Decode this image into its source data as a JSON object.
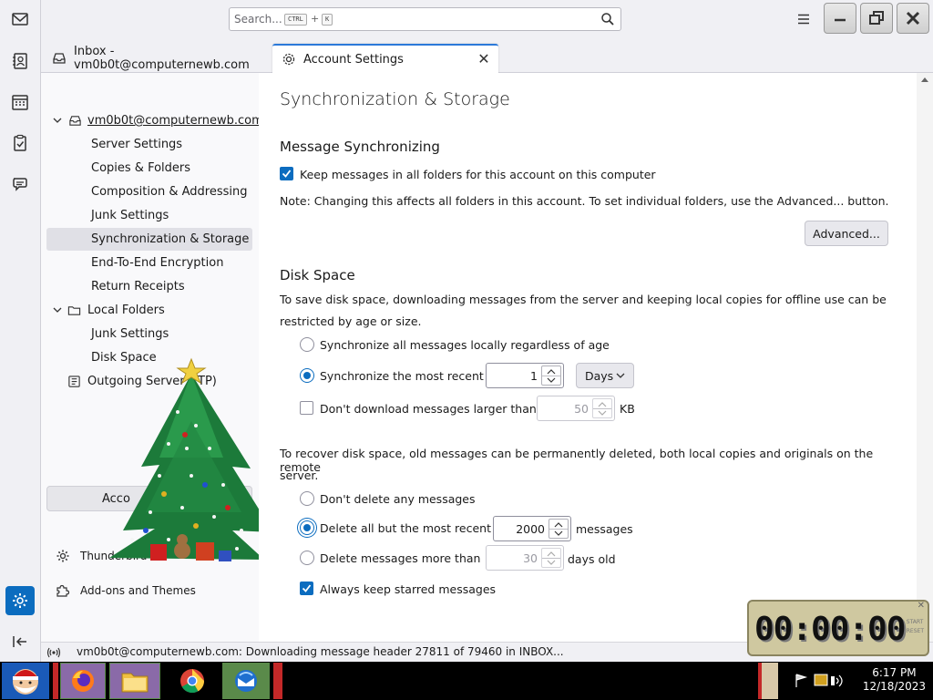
{
  "window": {
    "search_placeholder": "Search...",
    "search_kbd_ctrl": "CTRL",
    "search_kbd_plus": "+",
    "search_kbd_key": "K"
  },
  "tabs": [
    {
      "label": "Inbox - vm0b0t@computernewb.com",
      "icon": "inbox-icon"
    },
    {
      "label": "Account Settings",
      "icon": "gear-icon",
      "selected": true
    }
  ],
  "sidebar": {
    "account": "vm0b0t@computernewb.com",
    "account_items": [
      "Server Settings",
      "Copies & Folders",
      "Composition & Addressing",
      "Junk Settings",
      "Synchronization & Storage",
      "End-To-End Encryption",
      "Return Receipts"
    ],
    "selected": "Synchronization & Storage",
    "local_folders": "Local Folders",
    "local_items": [
      "Junk Settings",
      "Disk Space"
    ],
    "outgoing": "Outgoing Server (SMTP)",
    "outgoing_visible": "Outgoing Server (",
    "outgoing_tail": "TP)",
    "account_actions_visible": "Acco",
    "settings_link_visible": "Thunderbird S",
    "addons_link": "Add-ons and Themes"
  },
  "content": {
    "page_title": "Synchronization & Storage",
    "msg_sync_heading": "Message Synchronizing",
    "keep_messages_label": "Keep messages in all folders for this account on this computer",
    "keep_messages_checked": true,
    "note": "Note: Changing this affects all folders in this account. To set individual folders, use the Advanced... button.",
    "advanced_button": "Advanced...",
    "disk_space_heading": "Disk Space",
    "disk_space_desc_1": "To save disk space, downloading messages from the server and keeping local copies for offline use can be",
    "disk_space_desc_2": "restricted by age or size.",
    "sync_all_label": "Synchronize all messages locally regardless of age",
    "sync_recent_label": "Synchronize the most recent",
    "sync_recent_value": "1",
    "sync_recent_unit": "Days",
    "sync_recent_selected": true,
    "no_download_label": "Don't download messages larger than",
    "no_download_value": "50",
    "no_download_unit": "KB",
    "no_download_checked": false,
    "recover_desc_1": "To recover disk space, old messages can be permanently deleted, both local copies and originals on the remote",
    "recover_desc_2": "server.",
    "dont_delete_label": "Don't delete any messages",
    "delete_all_but_label": "Delete all but the most recent",
    "delete_all_but_value": "2000",
    "delete_all_but_unit": "messages",
    "delete_all_but_selected": true,
    "delete_older_label": "Delete messages more than",
    "delete_older_value": "30",
    "delete_older_unit": "days old",
    "keep_starred_label": "Always keep starred messages",
    "keep_starred_checked": true
  },
  "status": {
    "text": "vm0b0t@computernewb.com: Downloading message header 27811 of 79460 in INBOX..."
  },
  "timer": {
    "digits": "00:00:00",
    "side_top": "START",
    "side_bottom": "RESET"
  },
  "taskbar": {
    "time": "6:17 PM",
    "date": "12/18/2023"
  },
  "colors": {
    "accent": "#0b6cbf",
    "selected_row": "#e0e0e6"
  }
}
